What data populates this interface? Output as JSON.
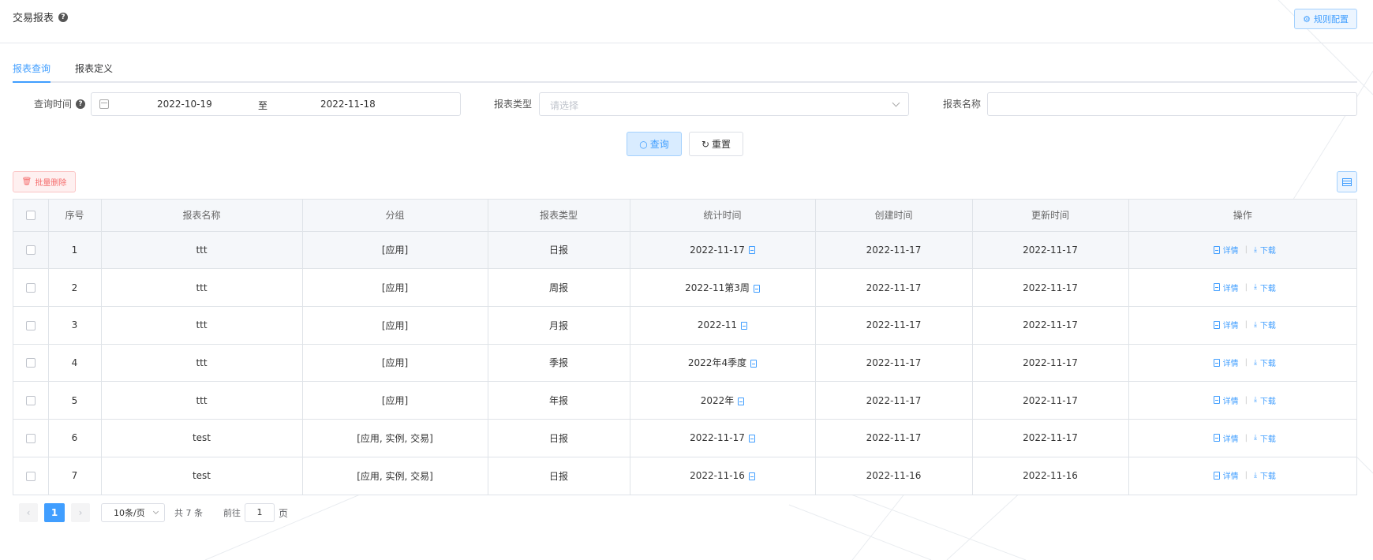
{
  "header": {
    "title": "交易报表",
    "rule_config_label": "规则配置"
  },
  "tabs": [
    {
      "label": "报表查询",
      "active": true
    },
    {
      "label": "报表定义",
      "active": false
    }
  ],
  "filters": {
    "query_time_label": "查询时间",
    "date_start": "2022-10-19",
    "date_separator": "至",
    "date_end": "2022-11-18",
    "report_type_label": "报表类型",
    "report_type_placeholder": "请选择",
    "report_name_label": "报表名称",
    "report_name_value": ""
  },
  "buttons": {
    "query": "查询",
    "reset": "重置",
    "batch_delete": "批量删除"
  },
  "table": {
    "columns": [
      "序号",
      "报表名称",
      "分组",
      "报表类型",
      "统计时间",
      "创建时间",
      "更新时间",
      "操作"
    ],
    "rows": [
      {
        "index": "1",
        "name": "ttt",
        "group": "[应用]",
        "type": "日报",
        "stat_time": "2022-11-17",
        "created": "2022-11-17",
        "updated": "2022-11-17"
      },
      {
        "index": "2",
        "name": "ttt",
        "group": "[应用]",
        "type": "周报",
        "stat_time": "2022-11第3周",
        "created": "2022-11-17",
        "updated": "2022-11-17"
      },
      {
        "index": "3",
        "name": "ttt",
        "group": "[应用]",
        "type": "月报",
        "stat_time": "2022-11",
        "created": "2022-11-17",
        "updated": "2022-11-17"
      },
      {
        "index": "4",
        "name": "ttt",
        "group": "[应用]",
        "type": "季报",
        "stat_time": "2022年4季度",
        "created": "2022-11-17",
        "updated": "2022-11-17"
      },
      {
        "index": "5",
        "name": "ttt",
        "group": "[应用]",
        "type": "年报",
        "stat_time": "2022年",
        "created": "2022-11-17",
        "updated": "2022-11-17"
      },
      {
        "index": "6",
        "name": "test",
        "group": "[应用, 实例, 交易]",
        "type": "日报",
        "stat_time": "2022-11-17",
        "created": "2022-11-17",
        "updated": "2022-11-17"
      },
      {
        "index": "7",
        "name": "test",
        "group": "[应用, 实例, 交易]",
        "type": "日报",
        "stat_time": "2022-11-16",
        "created": "2022-11-16",
        "updated": "2022-11-16"
      }
    ],
    "action_detail": "详情",
    "action_download": "下载"
  },
  "pagination": {
    "current_page": "1",
    "page_size": "10条/页",
    "total": "共 7 条",
    "goto_label": "前往",
    "goto_value": "1",
    "page_suffix": "页"
  },
  "colors": {
    "primary": "#409eff",
    "danger": "#f56c6c",
    "header_bg": "#f5f7fa"
  }
}
